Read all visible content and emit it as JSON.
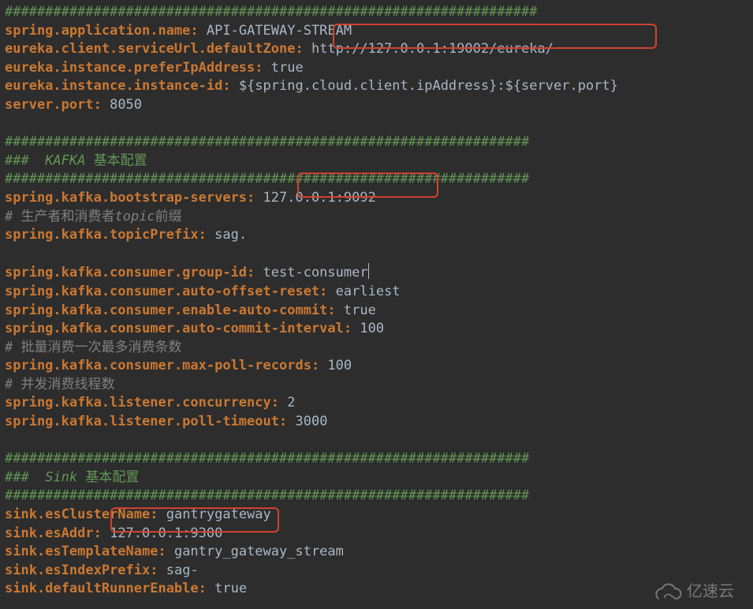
{
  "L1_hash": "##################################################################",
  "L2": {
    "k": "spring.application.name",
    "v": "API-GATEWAY-STREAM"
  },
  "L3": {
    "k": "eureka.client.serviceUrl.defaultZone",
    "v": "http://127.0.0.1:19002/eureka/"
  },
  "L4": {
    "k": "eureka.instance.preferIpAddress",
    "v": "true"
  },
  "L5": {
    "k": "eureka.instance.instance-id",
    "v": "${spring.cloud.client.ipAddress}:${server.port}"
  },
  "L6": {
    "k": "server.port",
    "v": "8050"
  },
  "L7_blank": "",
  "L8_hash": "#################################################################",
  "L9a": "###  ",
  "L9b": "KAFKA",
  "L9c": " 基本配置",
  "L10_hash": "#################################################################",
  "L11": {
    "k": "spring.kafka.bootstrap-servers",
    "v": "127.0.0.1:9092"
  },
  "L12a": "# 生产者和消费者",
  "L12b": "topic",
  "L12c": "前缀",
  "L13": {
    "k": "spring.kafka.topicPrefix",
    "v": "sag."
  },
  "L14_blank": "",
  "L15": {
    "k": "spring.kafka.consumer.group-id",
    "v": "test-consumer"
  },
  "L16": {
    "k": "spring.kafka.consumer.auto-offset-reset",
    "v": "earliest"
  },
  "L17": {
    "k": "spring.kafka.consumer.enable-auto-commit",
    "v": "true"
  },
  "L18": {
    "k": "spring.kafka.consumer.auto-commit-interval",
    "v": "100"
  },
  "L19": "# 批量消费一次最多消费条数",
  "L20": {
    "k": "spring.kafka.consumer.max-poll-records",
    "v": "100"
  },
  "L21": "# 并发消费线程数",
  "L22": {
    "k": "spring.kafka.listener.concurrency",
    "v": "2"
  },
  "L23": {
    "k": "spring.kafka.listener.poll-timeout",
    "v": "3000"
  },
  "L24_blank": "",
  "L25_hash": "#################################################################",
  "L26a": "###  ",
  "L26b": "Sink",
  "L26c": " 基本配置",
  "L27_hash": "#################################################################",
  "L28": {
    "k": "sink.esClusterName",
    "v": "gantrygateway"
  },
  "L29": {
    "k": "sink.esAddr",
    "v": "127.0.0.1:9300"
  },
  "L30": {
    "k": "sink.esTemplateName",
    "v": "gantry_gateway_stream"
  },
  "L31": {
    "k": "sink.esIndexPrefix",
    "v": "sag-"
  },
  "L32": {
    "k": "sink.defaultRunnerEnable",
    "v": "true"
  },
  "watermark": "亿速云"
}
